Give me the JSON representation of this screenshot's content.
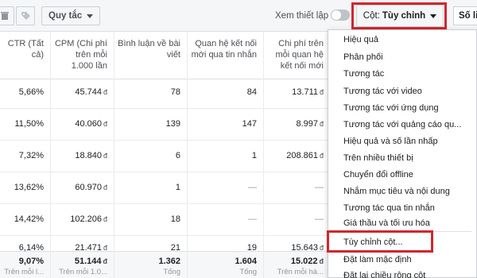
{
  "toolbar": {
    "quy_tac_label": "Quy tắc",
    "xem_thiet_lap_label": "Xem thiết lập",
    "cot_prefix": "Cột:",
    "cot_value": "Tùy chỉnh",
    "so_lieu_label": "Số li"
  },
  "table": {
    "columns": [
      {
        "header": "CTR (Tất cả)",
        "values": [
          "5,66%",
          "11,50%",
          "7,32%",
          "13,62%",
          "14,42%",
          "6,14%"
        ],
        "total": "9,07%",
        "total_sub": "Trên mỗi l..."
      },
      {
        "header": "CPM (Chi phí trên mỗi 1.000 lần",
        "values": [
          "45.744",
          "40.060",
          "18.840",
          "60.970",
          "102.206",
          "21.471"
        ],
        "total": "51.144",
        "total_sub": "Trên mỗi 1.0..."
      },
      {
        "header": "Bình luận về bài viết",
        "values": [
          "78",
          "139",
          "6",
          "1",
          "18",
          "21"
        ],
        "total": "1.362",
        "total_sub": "Tổng"
      },
      {
        "header": "Quan hệ kết nối mới qua tin nhắn",
        "values": [
          "84",
          "147",
          "1",
          "—",
          "—",
          "19"
        ],
        "total": "1.604",
        "total_sub": "Tổng"
      },
      {
        "header": "Chi phí trên mỗi quan hệ kết nối mới",
        "values": [
          "13.711",
          "8.997",
          "208.861",
          "—",
          "—",
          "15.643"
        ],
        "total": "15.022",
        "total_sub": "Trên mỗi hà..."
      }
    ],
    "currency": "đ"
  },
  "dropdown": {
    "items": [
      "Hiệu quả",
      "Phân phối",
      "Tương tác",
      "Tương tác với video",
      "Tương tác với ứng dụng",
      "Tương tác với quảng cáo qu...",
      "Hiệu quả và số lần nhấp",
      "Trên nhiều thiết bị",
      "Chuyển đổi offline",
      "Nhắm mục tiêu và nội dung",
      "Tương tác qua tin nhắn",
      "Giá thầu và tối ưu hóa"
    ],
    "footer_items": [
      "Tùy chỉnh cột...",
      "Đặt làm mặc định",
      "Đặt lại chiều rộng cột"
    ]
  },
  "colors": {
    "highlight_red": "#d0262e",
    "toolbar_bg": "#f5f6f7"
  }
}
